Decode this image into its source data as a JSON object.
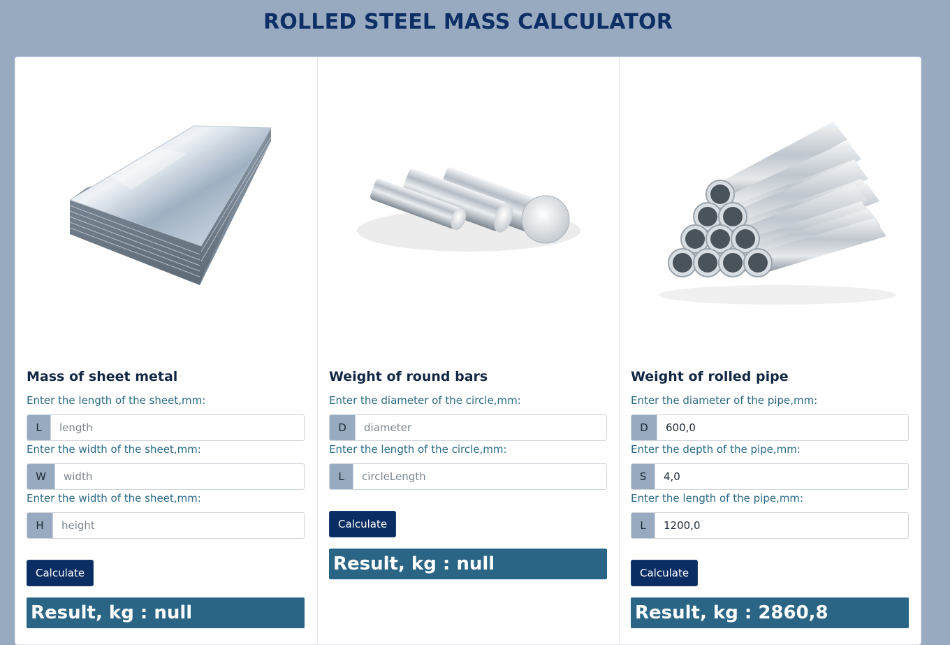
{
  "page": {
    "title": "ROLLED STEEL MASS CALCULATOR"
  },
  "colors": {
    "background": "#97aabf",
    "title": "#0d2f66",
    "button": "#0a2d63",
    "result": "#2b6585",
    "label": "#2c6a86"
  },
  "sheet": {
    "image_icon": "steel-sheet-stack-image",
    "title": "Mass of sheet metal",
    "fields": [
      {
        "label": "Enter the length of the sheet,mm:",
        "addon": "L",
        "placeholder": "length",
        "value": ""
      },
      {
        "label": "Enter the width of the sheet,mm:",
        "addon": "W",
        "placeholder": "width",
        "value": ""
      },
      {
        "label": "Enter the width of the sheet,mm:",
        "addon": "H",
        "placeholder": "height",
        "value": ""
      }
    ],
    "button": "Calculate",
    "result": "Result, kg : null"
  },
  "bars": {
    "image_icon": "round-bars-image",
    "title": "Weight of round bars",
    "fields": [
      {
        "label": "Enter the diameter of the circle,mm:",
        "addon": "D",
        "placeholder": "diameter",
        "value": ""
      },
      {
        "label": "Enter the length of the circle,mm:",
        "addon": "L",
        "placeholder": "circleLength",
        "value": ""
      }
    ],
    "button": "Calculate",
    "result": "Result, kg : null"
  },
  "pipe": {
    "image_icon": "pipe-stack-image",
    "title": "Weight of rolled pipe",
    "fields": [
      {
        "label": "Enter the diameter of the pipe,mm:",
        "addon": "D",
        "placeholder": "",
        "value": "600,0"
      },
      {
        "label": "Enter the depth of the pipe,mm:",
        "addon": "S",
        "placeholder": "",
        "value": "4,0"
      },
      {
        "label": "Enter the length of the pipe,mm:",
        "addon": "L",
        "placeholder": "",
        "value": "1200,0"
      }
    ],
    "button": "Calculate",
    "result": "Result, kg : 2860,8"
  }
}
